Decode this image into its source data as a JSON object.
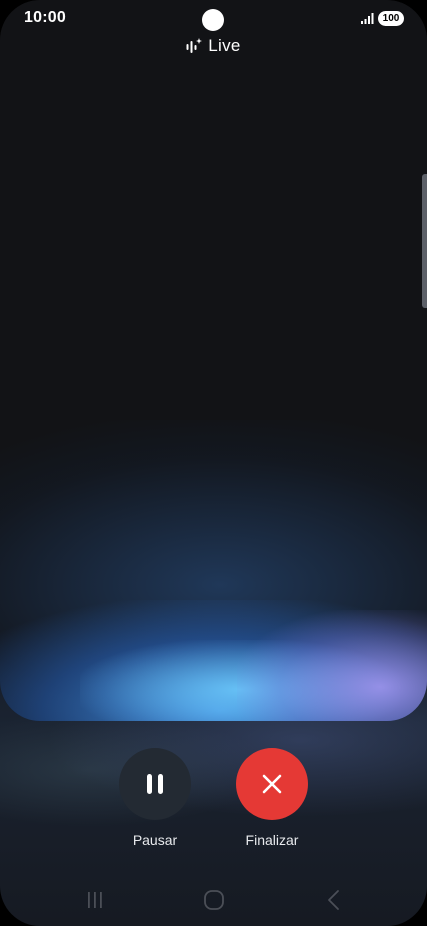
{
  "status_bar": {
    "time": "10:00",
    "battery": "100",
    "signal_icon": "signal-bars-icon"
  },
  "header": {
    "title": "Live",
    "icon": "live-sparkle-icon"
  },
  "controls": {
    "pause_label": "Pausar",
    "pause_icon": "pause-icon",
    "end_label": "Finalizar",
    "end_icon": "close-icon"
  },
  "colors": {
    "end_button": "#e53935",
    "pause_button": "#232a33",
    "background": "#121316"
  },
  "nav_bar": {
    "recents_icon": "recents-icon",
    "home_icon": "home-icon",
    "back_icon": "back-icon"
  }
}
